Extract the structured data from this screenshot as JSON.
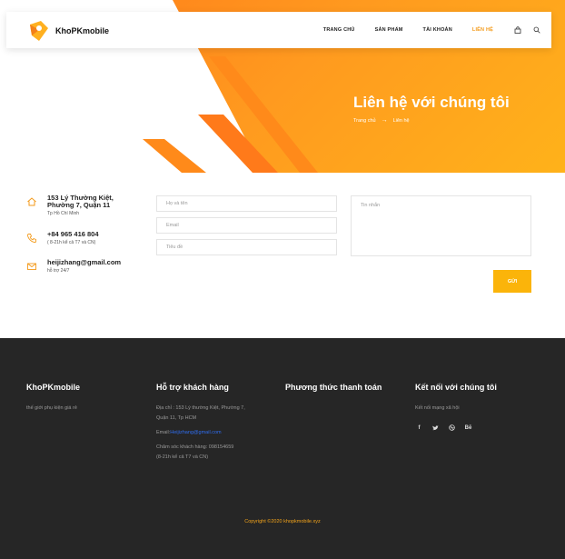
{
  "brand": {
    "name": "KhoPKmobile",
    "accent": "#f39a1a",
    "button": "#fbb40a"
  },
  "nav": {
    "items": [
      {
        "label": "TRANG CHỦ"
      },
      {
        "label": "SẢN PHẨM"
      },
      {
        "label": "TÀI KHOẢN"
      },
      {
        "label": "LIÊN HỆ"
      }
    ],
    "active": "LIÊN HỆ",
    "icons": [
      "bag-icon",
      "search-icon"
    ]
  },
  "hero": {
    "title": "Liên hệ với chúng tôi",
    "breadcrumb": {
      "home": "Trang chủ",
      "current": "Liên hệ"
    }
  },
  "contact": {
    "address": {
      "line1": "153 Lý Thường Kiệt,",
      "line2": "Phường 7, Quận 11",
      "sub": "Tp Hồ Chí Minh"
    },
    "phone": {
      "main": "+84 965 416 804",
      "sub": "( 8-21h kể cả T7 và CN)"
    },
    "email": {
      "main": "heijizhang@gmail.com",
      "sub": "hỗ trợ 24/7"
    }
  },
  "form": {
    "name_placeholder": "Họ và tên",
    "email_placeholder": "Email",
    "subject_placeholder": "Tiêu đề",
    "message_placeholder": "Tin nhắn",
    "submit_label": "GỬI"
  },
  "footer": {
    "col1": {
      "title": "KhoPKmobile",
      "text": "thế giới phụ kiện giá rẻ"
    },
    "col2": {
      "title": "Hỗ trợ khách hàng",
      "address": "Địa chỉ : 153 Lý thường Kiệt, Phường 7,",
      "address2": "Quận 11, Tp HCM",
      "email_label": "Email:",
      "email": "Heijizhang@gmail.com",
      "care": "Chăm sóc khách hàng: 098154659",
      "care_hours": "(8-21h kể cả T7 và CN)"
    },
    "col3": {
      "title": "Phương thức thanh toán"
    },
    "col4": {
      "title": "Kết nối với chúng tôi",
      "text": "Kết nối mạng xã hội",
      "socials": [
        "f",
        "t",
        "dribbble",
        "Bē"
      ]
    },
    "copyright": "Copyright ©2020 khopkmobile.xyz"
  }
}
